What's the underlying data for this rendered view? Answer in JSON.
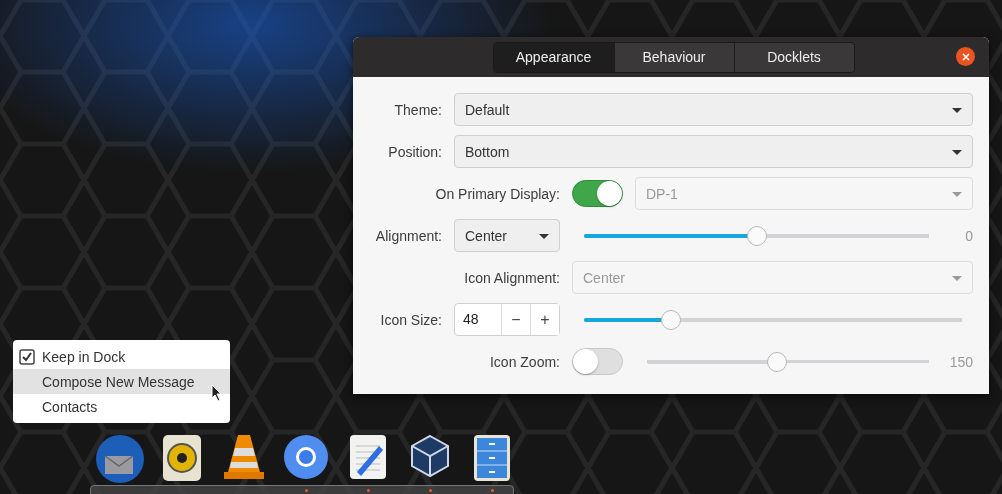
{
  "dialog": {
    "tabs": [
      {
        "label": "Appearance",
        "selected": true
      },
      {
        "label": "Behaviour",
        "selected": false
      },
      {
        "label": "Docklets",
        "selected": false
      }
    ],
    "rows": [
      {
        "kind": "dropdown",
        "label": "Theme:",
        "value": "Default",
        "disabled": false
      },
      {
        "kind": "dropdown",
        "label": "Position:",
        "value": "Bottom",
        "disabled": false,
        "children": [
          {
            "kind": "switch-dropdown",
            "label": "On Primary Display:",
            "on": true,
            "value": "DP-1",
            "disabled": true
          }
        ]
      },
      {
        "kind": "dropdown-slider",
        "label": "Alignment:",
        "value": "Center",
        "level": 0.5,
        "reading": "0",
        "children": [
          {
            "kind": "dropdown",
            "label": "Icon Alignment:",
            "value": "Center",
            "disabled": true
          }
        ]
      },
      {
        "kind": "spin-slider",
        "label": "Icon Size:",
        "value": "48",
        "level": 0.23,
        "minus": "−",
        "plus": "+",
        "children": [
          {
            "kind": "switch-slider",
            "label": "Icon Zoom:",
            "on": false,
            "level": 0.46,
            "reading": "150"
          }
        ]
      }
    ]
  },
  "context_menu": [
    {
      "kind": "check",
      "label": "Keep in Dock",
      "checked": true,
      "selected": false
    },
    {
      "kind": "plain",
      "label": "Compose New Message",
      "selected": true
    },
    {
      "kind": "plain",
      "label": "Contacts",
      "selected": false
    }
  ],
  "dock": [
    {
      "kind": "mail",
      "running": false
    },
    {
      "kind": "speaker",
      "running": false
    },
    {
      "kind": "cone",
      "running": false
    },
    {
      "kind": "browser",
      "running": true
    },
    {
      "kind": "editor",
      "running": true
    },
    {
      "kind": "cube",
      "running": true
    },
    {
      "kind": "cabinet",
      "running": true
    }
  ]
}
